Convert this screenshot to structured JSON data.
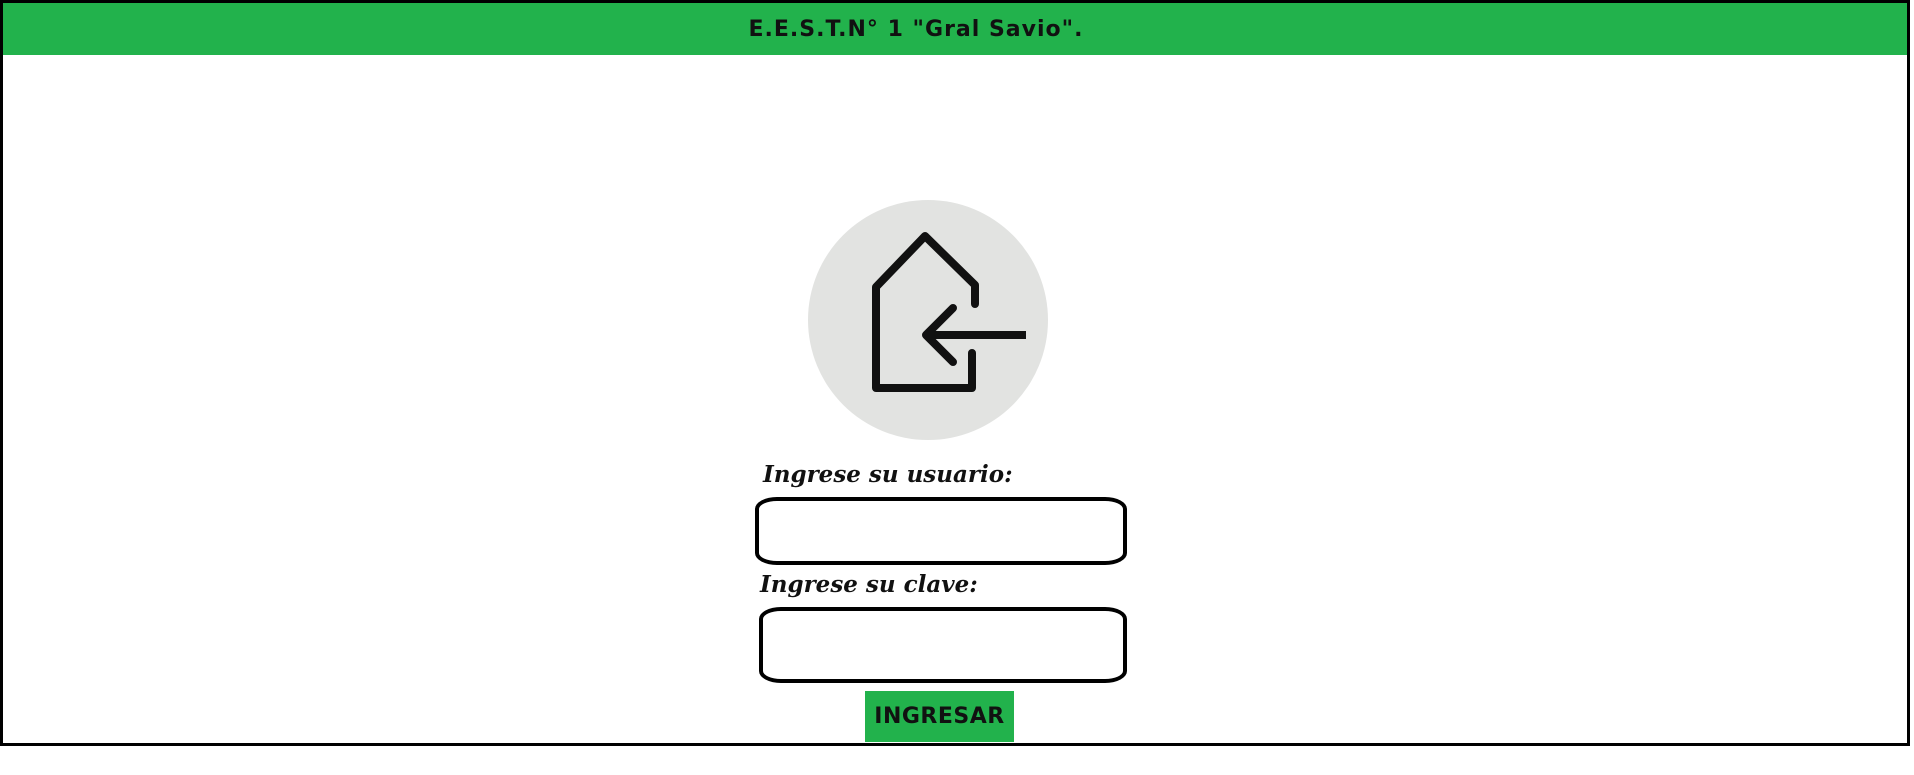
{
  "header": {
    "title": "E.E.S.T.N° 1 \"Gral Savio\".",
    "background_color": "#22b24c"
  },
  "login_icon": {
    "icon": "login-home-arrow-icon",
    "circle_color": "#e2e3e1"
  },
  "form": {
    "username_label": "Ingrese su usuario:",
    "username_value": "",
    "password_label": "Ingrese su clave:",
    "password_value": "",
    "submit_label": "INGRESAR",
    "submit_color": "#22b24c"
  }
}
